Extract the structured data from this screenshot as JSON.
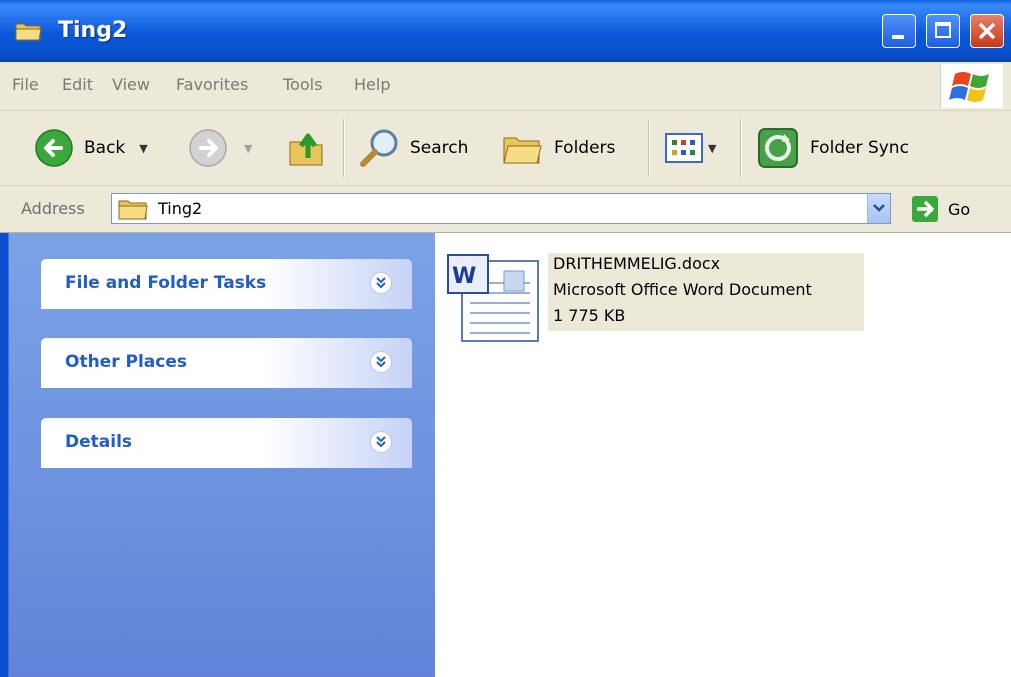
{
  "window": {
    "title": "Ting2"
  },
  "menu": [
    "File",
    "Edit",
    "View",
    "Favorites",
    "Tools",
    "Help"
  ],
  "toolbar": {
    "back_label": "Back",
    "search_label": "Search",
    "folders_label": "Folders",
    "folder_sync_label": "Folder Sync"
  },
  "address": {
    "label": "Address",
    "value": "Ting2",
    "go_label": "Go"
  },
  "task_pane": {
    "sections": [
      {
        "title": "File and Folder Tasks"
      },
      {
        "title": "Other Places"
      },
      {
        "title": "Details"
      }
    ]
  },
  "files": [
    {
      "name": "DRITHEMMELIG.docx",
      "type": "Microsoft Office Word Document",
      "size": "1 775 KB"
    }
  ],
  "colors": {
    "titlebar": "#0a58d8",
    "task_title": "#215dc6",
    "task_pane": "#6f94e0",
    "selection_bg": "#ece9d8"
  }
}
